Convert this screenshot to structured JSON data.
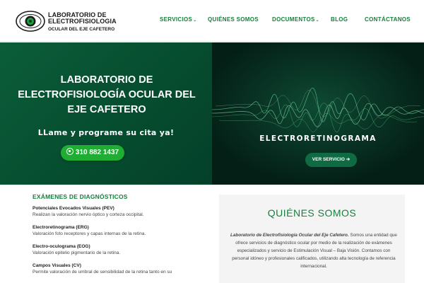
{
  "header": {
    "logo": {
      "line1": "LABORATORIO DE",
      "line2": "ELECTROFISIOLOGIA",
      "line3": "OCULAR DEL EJE CAFETERO"
    },
    "nav": [
      {
        "label": "SERVICIOS",
        "has_dropdown": true
      },
      {
        "label": "QUIÉNES SOMOS",
        "has_dropdown": false
      },
      {
        "label": "DOCUMENTOS",
        "has_dropdown": true
      },
      {
        "label": "BLOG",
        "has_dropdown": false
      },
      {
        "label": "CONTÁCTANOS",
        "has_dropdown": false
      }
    ]
  },
  "hero_left": {
    "title": "LABORATORIO DE ELECTROFISIOLOGÍA OCULAR DEL EJE CAFETERO",
    "subtitle": "LLame y programe su cita ya!",
    "phone_button": "310 882 1437"
  },
  "hero_right": {
    "label": "ELECTRORETINOGRAMA",
    "button": "VER SERVICIO"
  },
  "exams": {
    "heading": "EXÁMENES DE DIAGNÓSTICOS",
    "items": [
      {
        "name": "Potenciales Evocados Visuales (PEV)",
        "desc": "Realizan la valoración nervio óptico y corteza occipital."
      },
      {
        "name": "Electroretinograma (ERG)",
        "desc": "Valoración foto receptores y capas internas de la retina."
      },
      {
        "name": "Electro-oculograma (EOG)",
        "desc": "Valoración epitelio pigmentario de la retina."
      },
      {
        "name": "Campos Visuales (CV)",
        "desc": "Permite valoración de umbral de sensibilidad de la retina tanto en su"
      }
    ]
  },
  "about": {
    "title": "QUIÉNES SOMOS",
    "lab_name": "Laboratorio de Electrofisiología Ocular del Eje Cafetero.",
    "text": " Somos una entidad que ofrece servicios de diagnóstico ocular por medio de la realización de exámenes especializados y servicio de Estimulación Visual – Baja Visión. Contamos con personal idóneo y profesionales calificados, utilizando alta tecnología de referencia internacional."
  },
  "colors": {
    "brand_green": "#15803d",
    "hero_dark": "#064d2f",
    "whatsapp_green": "#1fae33"
  },
  "icons": [
    "eye-logo-icon",
    "whatsapp-icon",
    "arrow-right-icon",
    "chevron-down-icon"
  ]
}
